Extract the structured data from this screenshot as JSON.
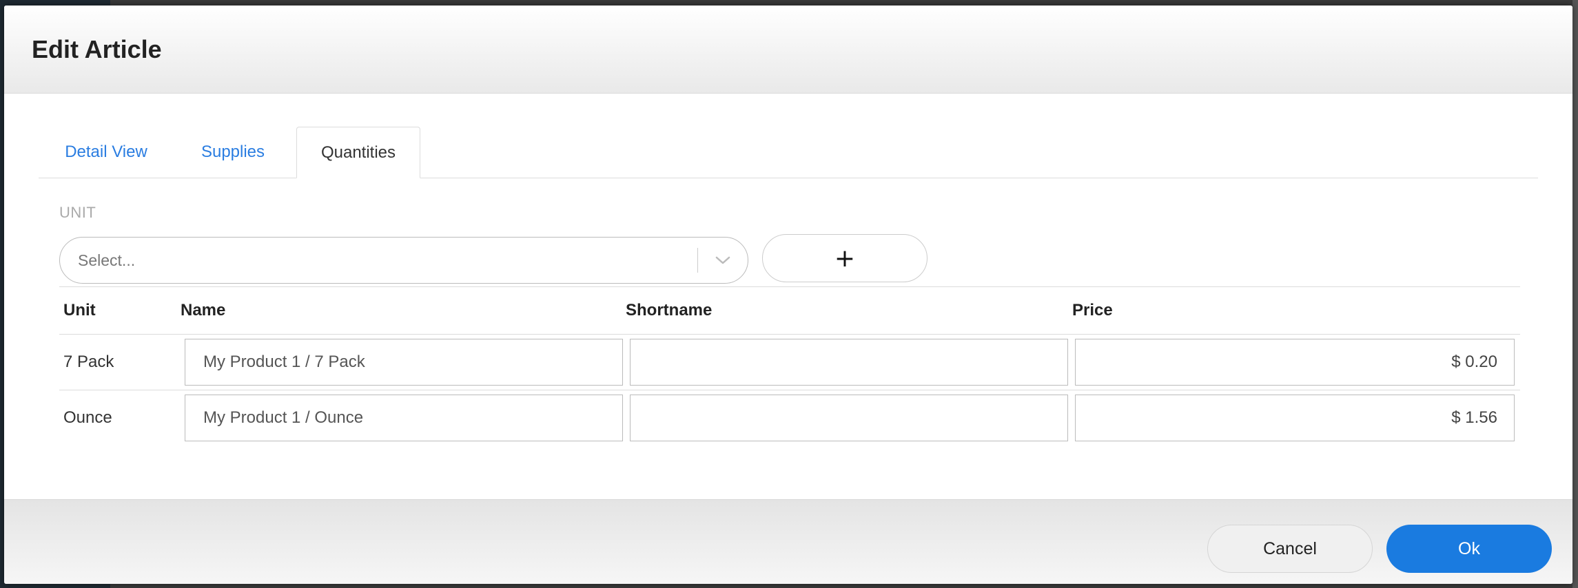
{
  "dialog": {
    "title": "Edit Article"
  },
  "tabs": [
    {
      "label": "Detail View",
      "active": false
    },
    {
      "label": "Supplies",
      "active": false
    },
    {
      "label": "Quantities",
      "active": true
    }
  ],
  "unit_section": {
    "label": "UNIT",
    "select_placeholder": "Select...",
    "add_button_label": "+"
  },
  "table": {
    "headers": {
      "unit": "Unit",
      "name": "Name",
      "shortname": "Shortname",
      "price": "Price"
    },
    "rows": [
      {
        "unit": "7 Pack",
        "name": "My Product 1 / 7 Pack",
        "shortname": "",
        "price": "$ 0.20"
      },
      {
        "unit": "Ounce",
        "name": "My Product 1 / Ounce",
        "shortname": "",
        "price": "$ 1.56"
      }
    ]
  },
  "footer": {
    "cancel_label": "Cancel",
    "ok_label": "Ok"
  },
  "colors": {
    "accent": "#1a7be0",
    "tab_link": "#2a7de1"
  },
  "icons": {
    "select_arrow": "chevron-down-icon"
  }
}
